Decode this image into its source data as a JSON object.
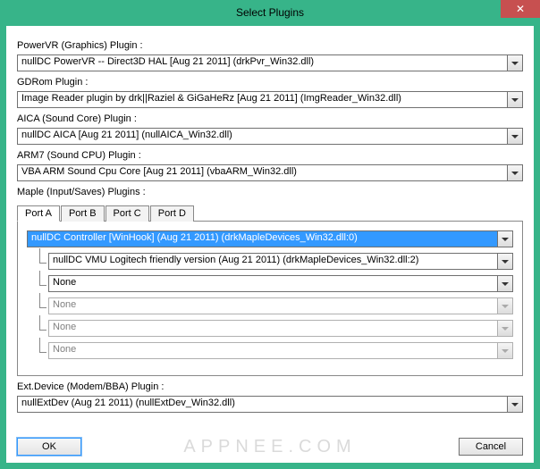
{
  "window": {
    "title": "Select Plugins",
    "close": "✕"
  },
  "labels": {
    "powerVR": "PowerVR (Graphics) Plugin :",
    "gdrom": "GDRom Plugin :",
    "aica": "AICA (Sound Core) Plugin :",
    "arm7": "ARM7 (Sound CPU) Plugin :",
    "maple": "Maple (Input/Saves) Plugins :",
    "extdev": "Ext.Device (Modem/BBA) Plugin :"
  },
  "values": {
    "powerVR": "nullDC PowerVR -- Direct3D HAL [Aug 21 2011] (drkPvr_Win32.dll)",
    "gdrom": "Image Reader plugin by drk||Raziel & GiGaHeRz [Aug 21 2011] (ImgReader_Win32.dll)",
    "aica": "nullDC AICA [Aug 21 2011] (nullAICA_Win32.dll)",
    "arm7": "VBA ARM Sound Cpu Core [Aug 21 2011] (vbaARM_Win32.dll)",
    "extdev": "nullExtDev (Aug 21 2011) (nullExtDev_Win32.dll)"
  },
  "tabs": {
    "portA": "Port A",
    "portB": "Port B",
    "portC": "Port C",
    "portD": "Port D"
  },
  "portA": {
    "main": "nullDC Controller [WinHook] (Aug 21 2011) (drkMapleDevices_Win32.dll:0)",
    "sub1": "nullDC VMU Logitech friendly version (Aug 21 2011) (drkMapleDevices_Win32.dll:2)",
    "sub2": "None",
    "sub3": "None",
    "sub4": "None",
    "sub5": "None"
  },
  "buttons": {
    "ok": "OK",
    "cancel": "Cancel"
  },
  "watermark": "APPNEE.COM"
}
